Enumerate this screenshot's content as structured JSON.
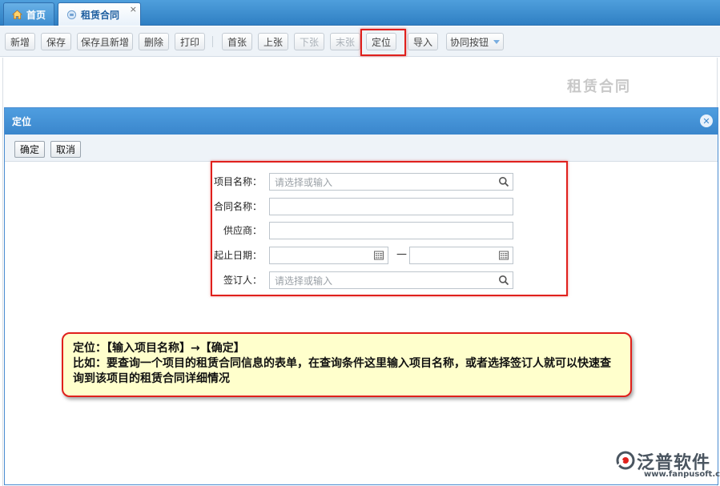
{
  "tabs": {
    "home": {
      "label": "首页",
      "icon": "home-icon"
    },
    "contract": {
      "label": "租赁合同",
      "icon": "document-icon",
      "close": "×"
    }
  },
  "toolbar": {
    "buttons": [
      {
        "label": "新增",
        "disabled": false
      },
      {
        "label": "保存",
        "disabled": false
      },
      {
        "label": "保存且新增",
        "disabled": false
      },
      {
        "label": "删除",
        "disabled": false
      },
      {
        "label": "打印",
        "disabled": false
      },
      {
        "label": "首张",
        "disabled": false
      },
      {
        "label": "上张",
        "disabled": false
      },
      {
        "label": "下张",
        "disabled": true
      },
      {
        "label": "末张",
        "disabled": true
      },
      {
        "label": "定位",
        "disabled": false,
        "highlighted": true
      },
      {
        "label": "导入",
        "disabled": false
      },
      {
        "label": "协同按钮",
        "disabled": false,
        "dropdown": true
      }
    ]
  },
  "document": {
    "title": "租赁合同"
  },
  "dialog": {
    "title": "定位",
    "confirm_label": "确定",
    "cancel_label": "取消",
    "fields": {
      "project_name": {
        "label": "项目名称：",
        "placeholder": "请选择或输入",
        "icon": "search-icon"
      },
      "contract_name": {
        "label": "合同名称：",
        "value": ""
      },
      "supplier": {
        "label": "供应商：",
        "value": ""
      },
      "date_range": {
        "label": "起止日期：",
        "separator": "—",
        "start_icon": "calendar-icon",
        "end_icon": "calendar-icon"
      },
      "signer": {
        "label": "签订人：",
        "placeholder": "请选择或输入",
        "icon": "search-icon"
      }
    }
  },
  "callout": {
    "line1": "定位：【输入项目名称】→【确定】",
    "line2": "比如：要查询一个项目的租赁合同信息的表单，在查询条件这里输入项目名称，或者选择签订人就可以快速查询到该项目的租赁合同详细情况"
  },
  "logo": {
    "name": "泛普软件",
    "url": "www.fanpusoft.com"
  },
  "colors": {
    "accent": "#3a86cc",
    "highlight": "#e0201c",
    "callout_bg": "#ffffcc"
  }
}
